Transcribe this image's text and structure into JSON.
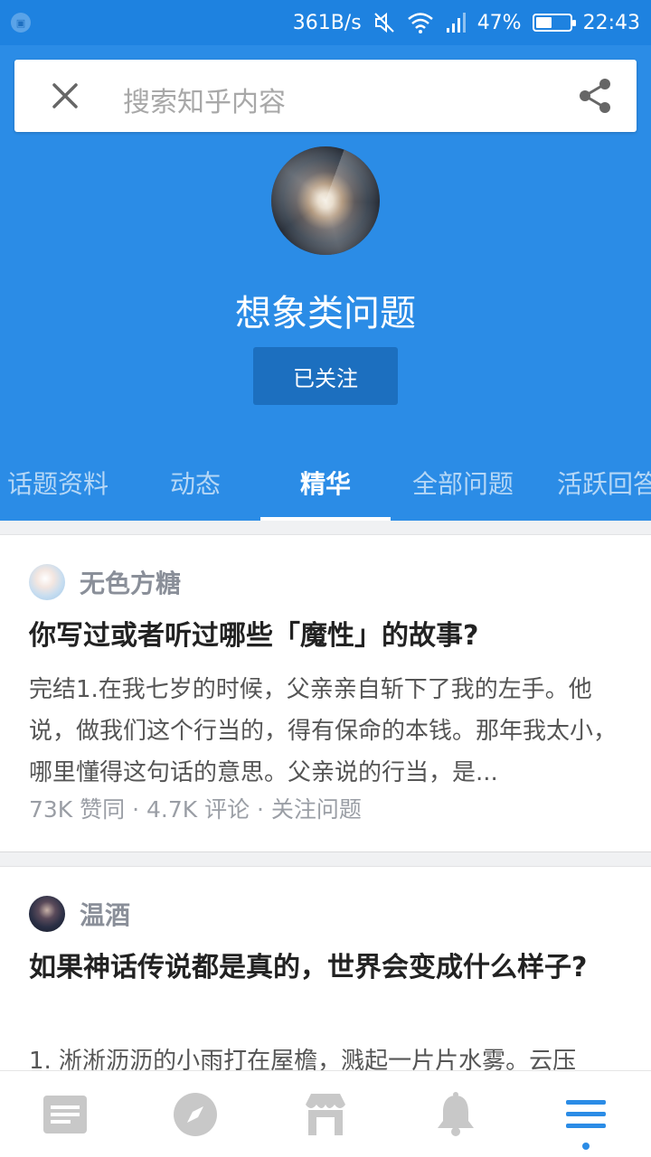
{
  "status_bar": {
    "net_speed": "361B/s",
    "battery": "47%",
    "battery_level": 0.47,
    "time": "22:43"
  },
  "search": {
    "placeholder": "搜索知乎内容"
  },
  "topic": {
    "title": "想象类问题",
    "follow_label": "已关注"
  },
  "tabs": [
    {
      "label": "话题资料"
    },
    {
      "label": "动态"
    },
    {
      "label": "精华"
    },
    {
      "label": "全部问题"
    },
    {
      "label": "活跃回答"
    }
  ],
  "active_tab": 2,
  "feed": [
    {
      "author": "无色方糖",
      "title": "你写过或者听过哪些「魔性」的故事?",
      "excerpt": "完结1.在我七岁的时候，父亲亲自斩下了我的左手。他说，做我们这个行当的，得有保命的本钱。那年我太小，哪里懂得这句话的意思。父亲说的行当，是...",
      "meta": "73K 赞同 · 4.7K 评论 · 关注问题"
    },
    {
      "author": "温酒",
      "title": "如果神话传说都是真的，世界会变成什么样子?",
      "excerpt": "1. 淅淅沥沥的小雨打在屋檐，溅起一片片水雾。云压"
    }
  ],
  "bottom_nav": [
    {
      "icon": "feed-icon"
    },
    {
      "icon": "compass-icon"
    },
    {
      "icon": "store-icon"
    },
    {
      "icon": "bell-icon"
    },
    {
      "icon": "menu-icon",
      "active": true
    }
  ],
  "colors": {
    "primary": "#2b8ce6",
    "status_bar": "#1e82e0",
    "follow_button": "#1c6fbf"
  }
}
